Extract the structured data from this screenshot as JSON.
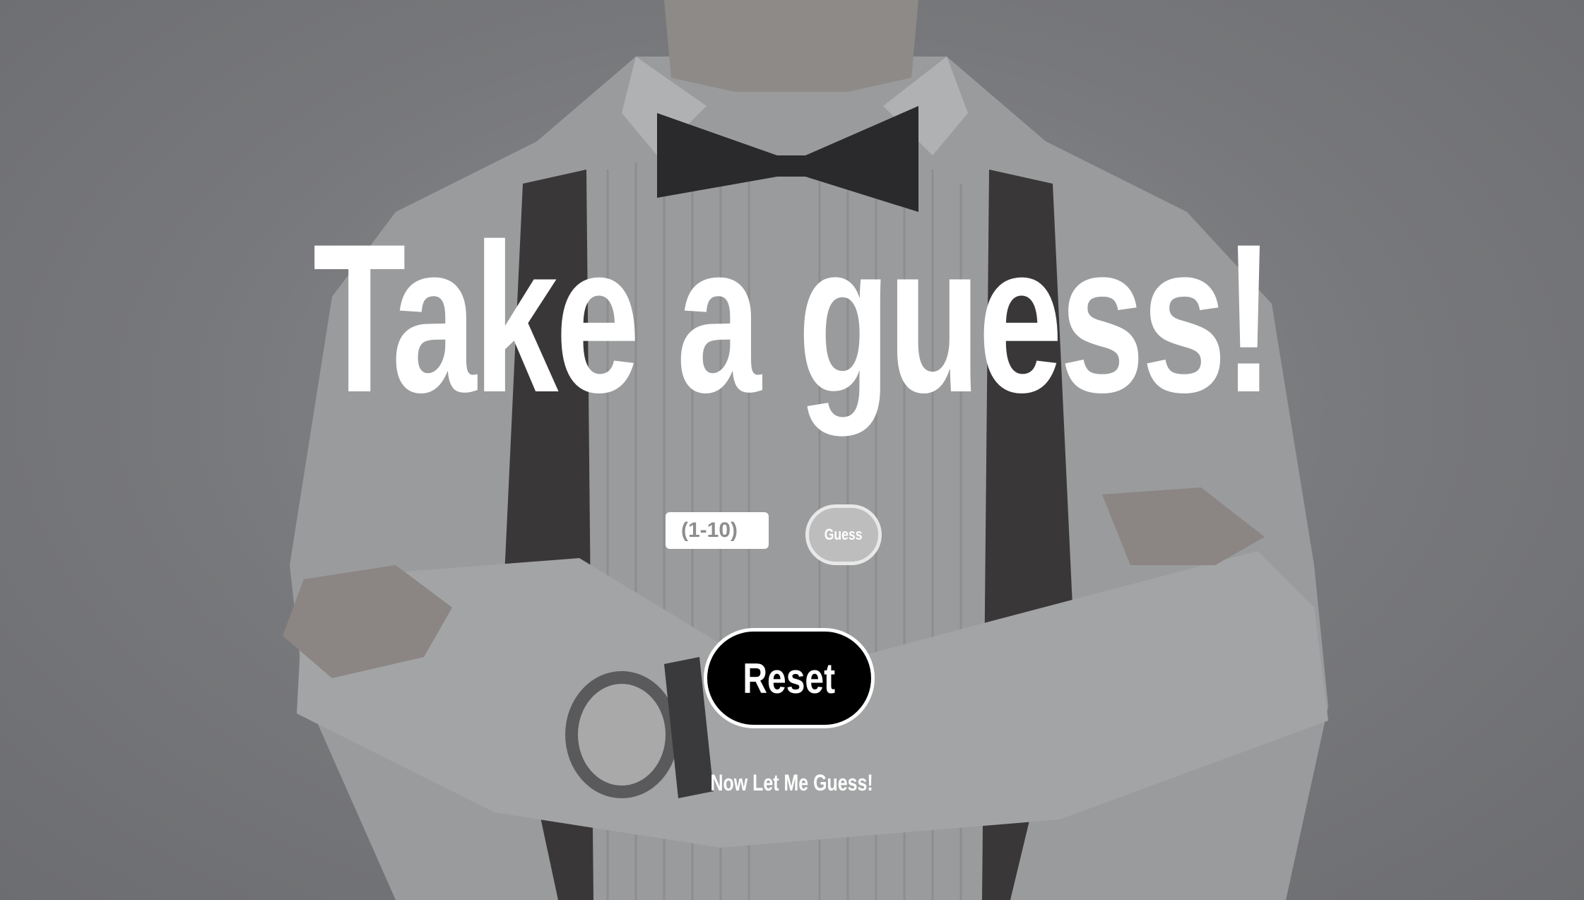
{
  "title": "Take a guess!",
  "guess_input": {
    "placeholder": "(1-10)",
    "value": ""
  },
  "guess_button_label": "Guess",
  "reset_button_label": "Reset",
  "computer_guess_link": "Now Let Me Guess!",
  "colors": {
    "overlay_gray": "#77787b",
    "title_text": "#ffffff",
    "guess_button_fill": "#bdbdbd",
    "reset_button_fill": "#000000",
    "button_border": "#ffffff"
  },
  "background_image": "man-in-white-shirt-bow-tie-suspenders-arms-crossed"
}
